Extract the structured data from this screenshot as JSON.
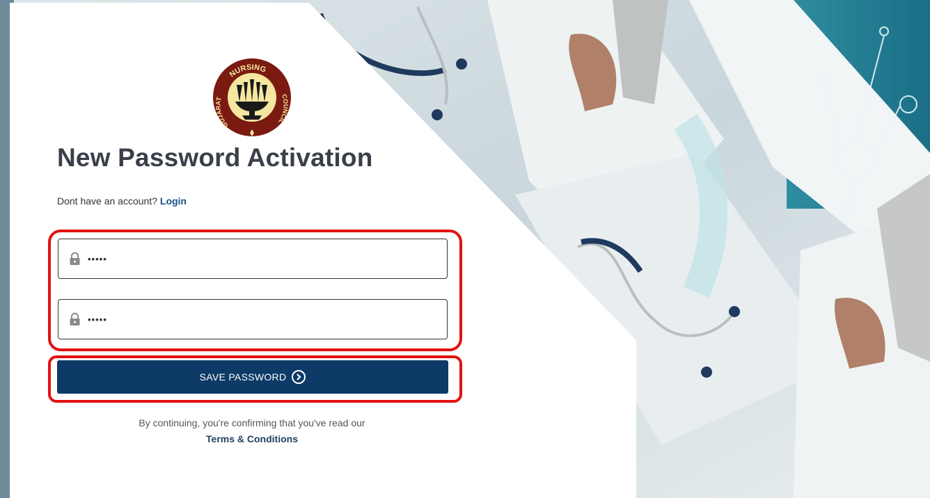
{
  "logo": {
    "arc_text_top": "NURSING",
    "arc_text_left": "GUJARAT",
    "arc_text_right": "COUNCIL",
    "colors": {
      "ring": "#7a1a10",
      "disc": "#f5e6a0",
      "emblem": "#1a1a1a"
    }
  },
  "page": {
    "title": "New Password Activation"
  },
  "signup": {
    "prompt": "Dont have an account?",
    "login_link": "Login"
  },
  "form": {
    "new_password": {
      "value": "•••••",
      "icon": "lock-icon"
    },
    "confirm_password": {
      "value": "•••••",
      "icon": "lock-icon"
    },
    "save_label": "SAVE PASSWORD",
    "save_icon": "chevron-right-circle-icon"
  },
  "consent": {
    "text": "By continuing, you're confirming that you've read our",
    "terms_link": "Terms & Conditions"
  },
  "colors": {
    "primary_button": "#0d3a66",
    "link": "#1d4f86",
    "highlight_border": "#e41111",
    "title": "#3a3f4a"
  }
}
